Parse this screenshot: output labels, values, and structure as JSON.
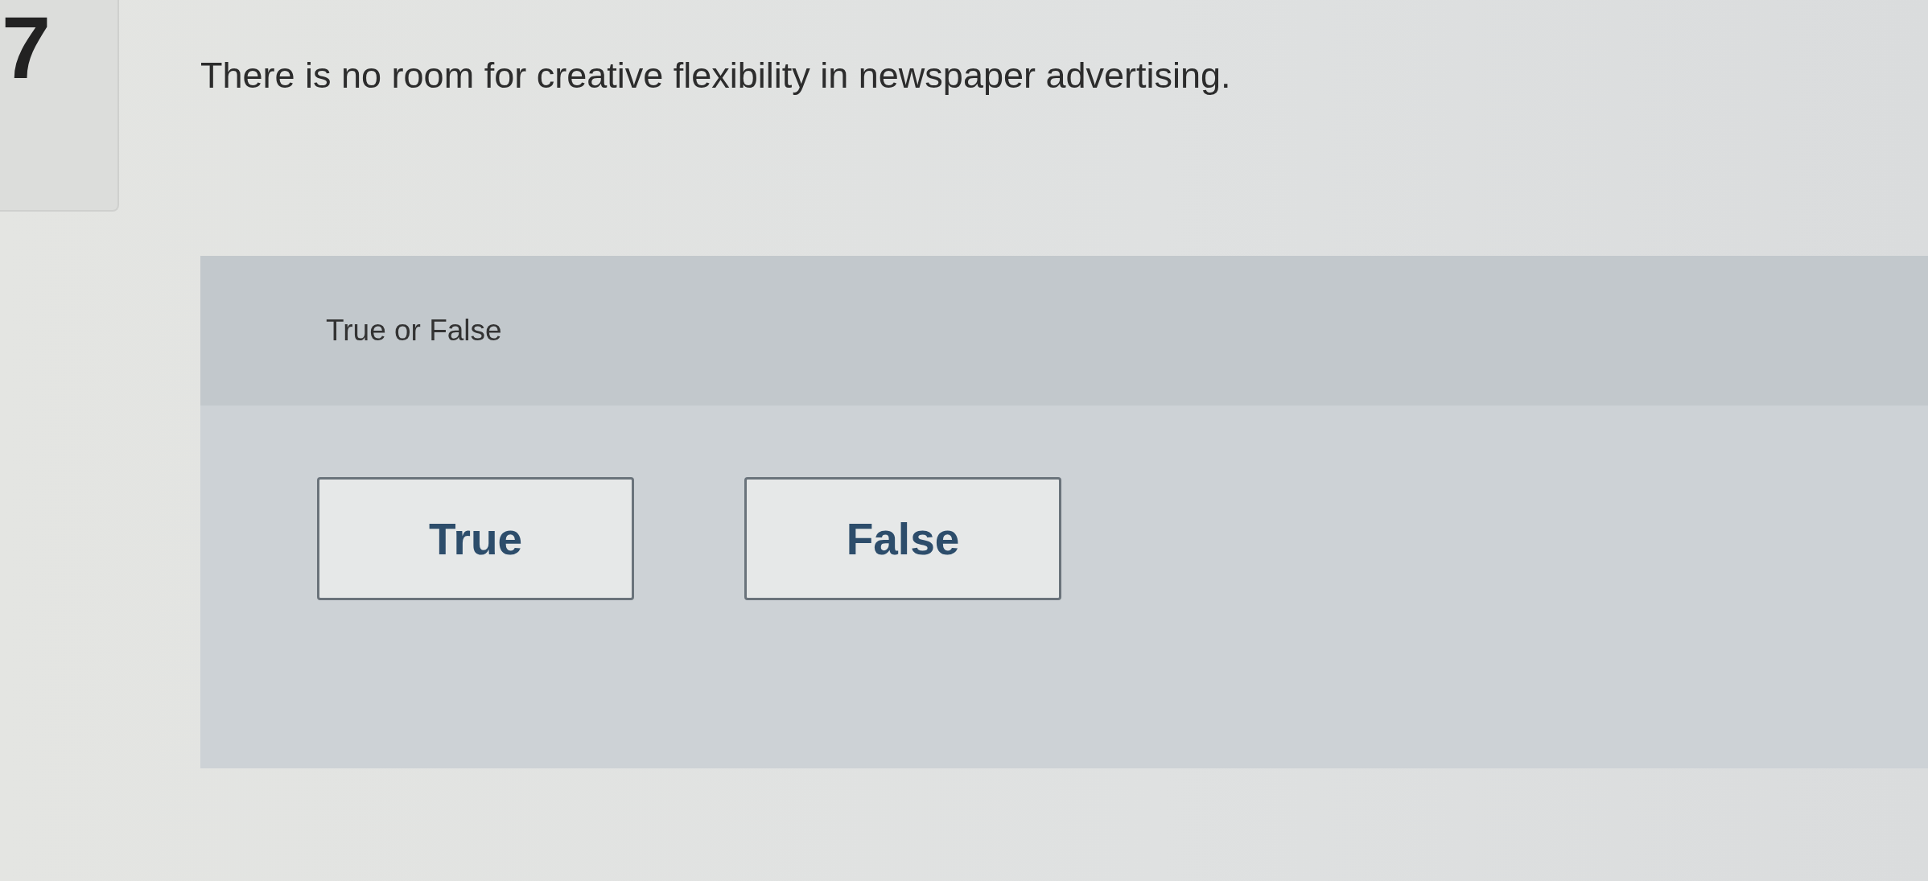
{
  "question_number": "7",
  "question": "There is no room for creative flexibility in newspaper advertising.",
  "answer_panel": {
    "instruction": "True or False",
    "options": [
      {
        "label": "True"
      },
      {
        "label": "False"
      }
    ]
  }
}
